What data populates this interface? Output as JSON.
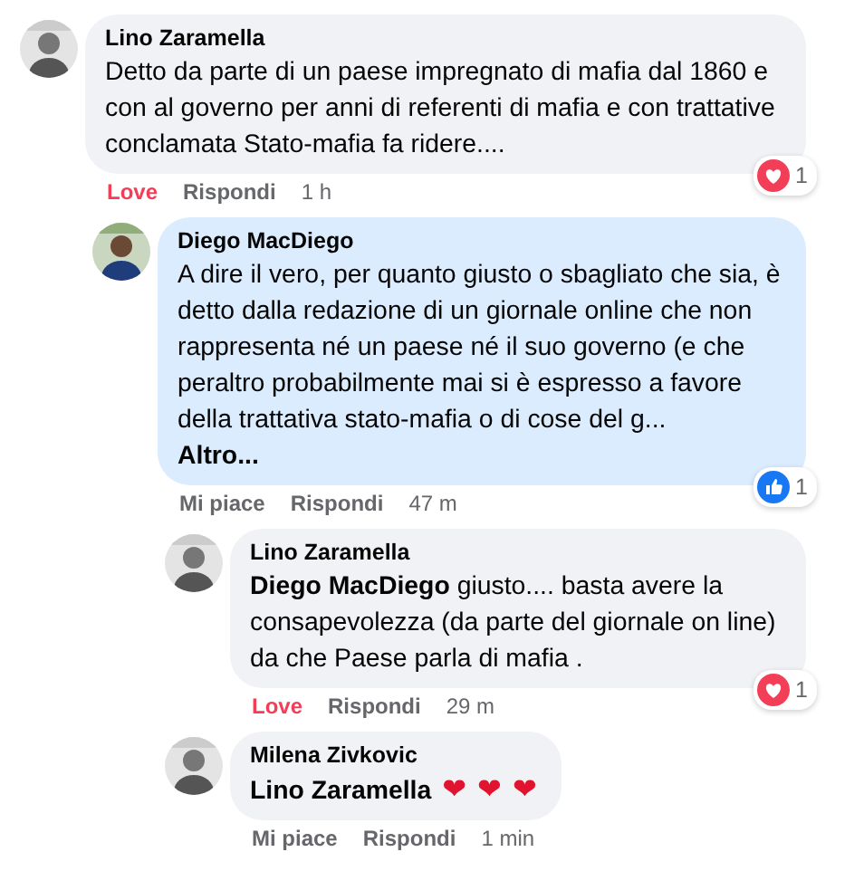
{
  "comments": [
    {
      "author": "Lino Zaramella",
      "text": "Detto da parte di un paese impregnato di mafia dal 1860 e con al governo per anni di referenti di mafia e con trattative conclamata Stato-mafia fa ridere....",
      "highlighted": false,
      "reaction": {
        "kind": "love",
        "count": "1"
      },
      "action": {
        "label": "Love",
        "reacted": true
      },
      "reply": "Rispondi",
      "time": "1 h",
      "children": [
        {
          "author": "Diego MacDiego",
          "text": "A dire il vero, per quanto giusto o sbagliato che sia, è detto dalla redazione di un giornale online che non rappresenta né un paese né il suo governo (e che peraltro probabilmente mai si è espresso a favore della trattativa stato-mafia o di cose del g...",
          "more": "Altro...",
          "highlighted": true,
          "reaction": {
            "kind": "like",
            "count": "1"
          },
          "action": {
            "label": "Mi piace",
            "reacted": false
          },
          "reply": "Rispondi",
          "time": "47 m",
          "children": [
            {
              "author": "Lino Zaramella",
              "text": "**Diego MacDiego** giusto.... basta avere la consapevolezza (da parte del giornale on line) da che Paese parla di mafia .",
              "highlighted": false,
              "reaction": {
                "kind": "love",
                "count": "1"
              },
              "action": {
                "label": "Love",
                "reacted": true
              },
              "reply": "Rispondi",
              "time": "29 m"
            },
            {
              "author": "Milena Zivkovic",
              "text": "**Lino Zaramella**",
              "emojis": [
                "❤",
                "❤",
                "❤"
              ],
              "highlighted": false,
              "action": {
                "label": "Mi piace",
                "reacted": false
              },
              "reply": "Rispondi",
              "time": "1 min"
            }
          ]
        }
      ]
    }
  ]
}
